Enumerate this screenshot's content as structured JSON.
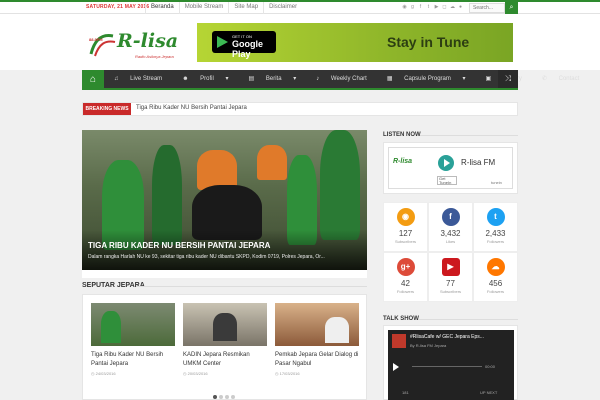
{
  "topbar": {
    "date": "SATURDAY, 21 MAY 2016",
    "nav": [
      "Beranda",
      "Mobile Stream",
      "Site Map",
      "Disclaimer"
    ],
    "search_placeholder": "Search..."
  },
  "header": {
    "logo_text": "R-lisa",
    "logo_tagline": "Radio Asiknya Jepara",
    "logo_freq": "88.8FM",
    "banner": {
      "gplay_top": "GET IT ON",
      "gplay_main": "Google Play",
      "tagline": "Stay in Tune"
    }
  },
  "mainnav": {
    "items": [
      "Live Stream",
      "Profil",
      "Berita",
      "Weekly Chart",
      "Capsule Program",
      "Gallery",
      "Contact"
    ]
  },
  "breaking": {
    "label": "BREAKING NEWS",
    "text": "Tiga Ribu Kader NU Bersih Pantai Jepara"
  },
  "slider": {
    "title": "TIGA RIBU KADER NU BERSIH PANTAI JEPARA",
    "excerpt": "Dalam rangka Harlah NU ke 93, sekitar tiga ribu kader NU dibantu SKPD, Kodim 0719, Polres Jepara, Or..."
  },
  "seputar": {
    "title": "SEPUTAR JEPARA",
    "cards": [
      {
        "title": "Tiga Ribu Kader NU Bersih Pantai Jepara",
        "date": "24/03/2016"
      },
      {
        "title": "KADIN Jepara Resmikan UMKM Center",
        "date": "20/03/2016"
      },
      {
        "title": "Pemkab Jepara Gelar Dialog di Pasar Ngabul",
        "date": "17/03/2016"
      }
    ]
  },
  "sidebar": {
    "listen_title": "LISTEN NOW",
    "tunein": {
      "name": "R-lisa FM",
      "button": "Get TuneIn",
      "brand": "tunein"
    },
    "stats": [
      {
        "icon": "rss-icon",
        "glyph": "◉",
        "color": "#f39c12",
        "num": "127",
        "label": "Subscribers"
      },
      {
        "icon": "facebook-icon",
        "glyph": "f",
        "color": "#3b5998",
        "num": "3,432",
        "label": "Likes"
      },
      {
        "icon": "twitter-icon",
        "glyph": "t",
        "color": "#1da1f2",
        "num": "2,433",
        "label": "Followers"
      },
      {
        "icon": "googleplus-icon",
        "glyph": "g+",
        "color": "#dd4b39",
        "num": "42",
        "label": "Followers"
      },
      {
        "icon": "youtube-icon",
        "glyph": "▶",
        "color": "#cc181e",
        "num": "77",
        "label": "Subscribers"
      },
      {
        "icon": "soundcloud-icon",
        "glyph": "☁",
        "color": "#ff7700",
        "num": "456",
        "label": "Followers"
      }
    ],
    "talk_title": "TALK SHOW",
    "talk": {
      "title": "#RlisaCafe w/ GEC Jepara Eps...",
      "sub": "By R-lisa FM Jepara",
      "time": "00:00",
      "count": "181",
      "next": "UP NEXT"
    }
  }
}
